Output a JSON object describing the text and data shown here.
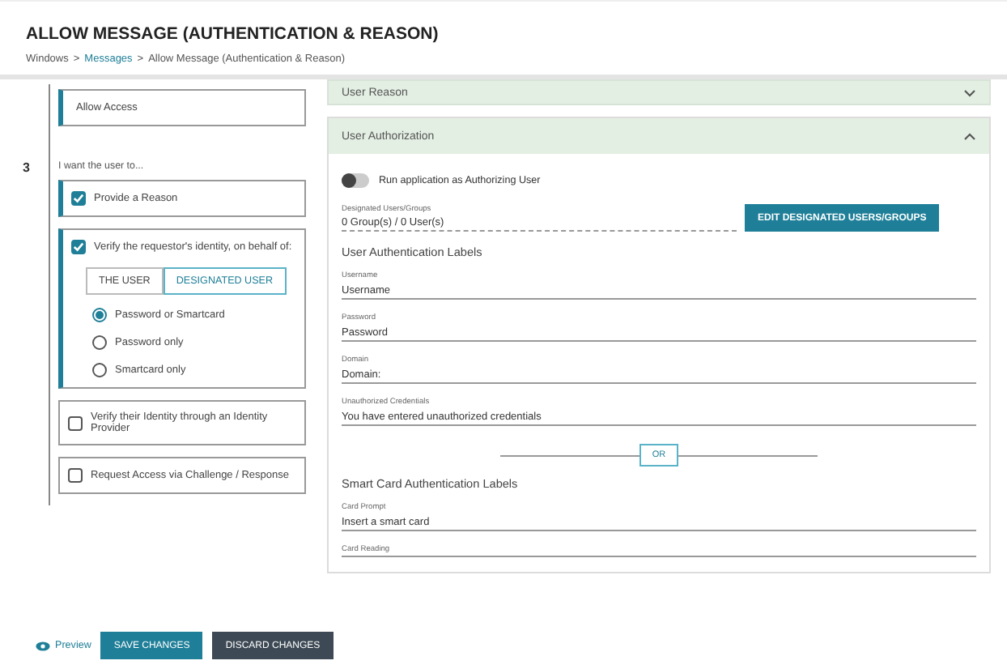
{
  "page": {
    "title": "ALLOW MESSAGE (AUTHENTICATION & REASON)",
    "breadcrumb": [
      {
        "label": "Windows",
        "link": false
      },
      {
        "label": ">",
        "link": false
      },
      {
        "label": "Messages",
        "link": true
      },
      {
        "label": ">",
        "link": false
      },
      {
        "label": "Allow Message (Authentication & Reason)",
        "link": false
      }
    ]
  },
  "left": {
    "action_box": "Allow Access",
    "step": "3",
    "prompt": "I want the user to...",
    "options": [
      {
        "kind": "check",
        "label": "Provide a Reason",
        "checked": true
      },
      {
        "kind": "verify",
        "label": "Verify the requestor's identity, on behalf of:",
        "checked": true,
        "tabs": [
          {
            "label": "THE USER",
            "selected": false
          },
          {
            "label": "DESIGNATED USER",
            "selected": true
          }
        ],
        "radios": [
          {
            "label": "Password or Smartcard",
            "selected": true
          },
          {
            "label": "Password only",
            "selected": false
          },
          {
            "label": "Smartcard only",
            "selected": false
          }
        ]
      },
      {
        "kind": "check",
        "label": "Verify their Identity through an Identity Provider",
        "checked": false
      },
      {
        "kind": "check",
        "label": "Request Access via Challenge / Response",
        "checked": false
      }
    ]
  },
  "right": {
    "sections": [
      {
        "title": "User Reason",
        "expanded": false
      },
      {
        "title": "User Authorization",
        "expanded": true
      }
    ],
    "toggle": {
      "label": "Run application as Authorizing User",
      "on": false
    },
    "designated": {
      "label": "Designated Users/Groups",
      "value": "0 Group(s) / 0 User(s)",
      "button": "EDIT DESIGNATED USERS/GROUPS"
    },
    "auth_heading": "User Authentication Labels",
    "auth_fields": [
      {
        "label": "Username",
        "value": "Username"
      },
      {
        "label": "Password",
        "value": "Password"
      },
      {
        "label": "Domain",
        "value": "Domain:"
      },
      {
        "label": "Unauthorized Credentials",
        "value": "You have entered unauthorized credentials"
      }
    ],
    "or": "OR",
    "smart_heading": "Smart Card Authentication Labels",
    "smart_fields": [
      {
        "label": "Card Prompt",
        "value": "Insert a smart card"
      },
      {
        "label": "Card Reading"
      }
    ]
  },
  "footer": {
    "preview": "Preview",
    "save": "SAVE CHANGES",
    "discard": "DISCARD CHANGES"
  }
}
